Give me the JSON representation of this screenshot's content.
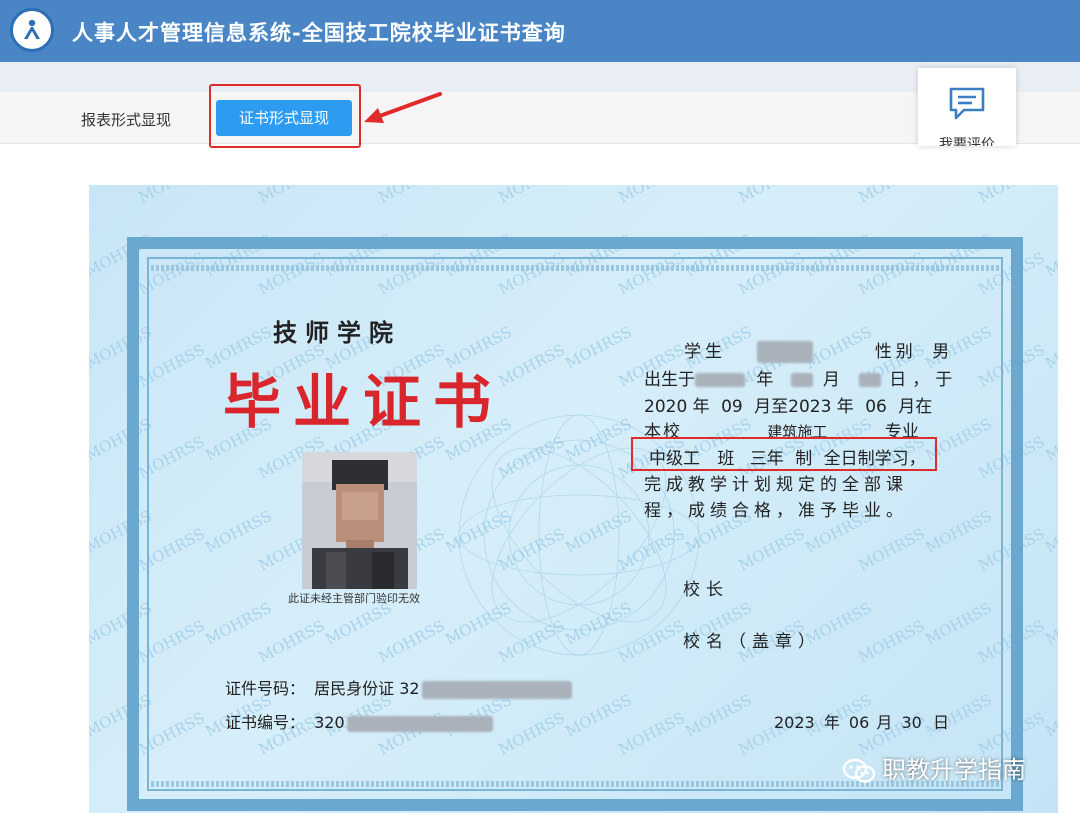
{
  "app": {
    "title": "人事人才管理信息系统-全国技工院校毕业证书查询"
  },
  "toolbar": {
    "report_view_label": "报表形式显现",
    "certificate_view_label": "证书形式显现",
    "feedback_label": "我要评价"
  },
  "certificate": {
    "school_name": "技师学院",
    "title": "毕业证书",
    "photo_note": "此证未经主管部门验印无效",
    "watermark_text": "MOHRSS",
    "student_label": "学生",
    "gender_label": "性别",
    "gender_value": "男",
    "birth_prefix": "出生于",
    "year_unit": "年",
    "month_unit": "月",
    "day_unit": "日，于",
    "start_year": "2020",
    "start_month": "09",
    "to_text": "至",
    "end_year": "2023",
    "end_month": "06",
    "month_at": "月在",
    "school_prefix": "本校",
    "major": "建筑施工",
    "major_suffix": "专业",
    "level": "中级工",
    "class_text": "班",
    "duration": "三年",
    "system_text": "制",
    "study_mode": "全日制学习，",
    "line_complete": "完成教学计划规定的全部课",
    "line_pass": "程，成绩合格，准予毕业。",
    "principal_label": "校长",
    "seal_label": "校名（盖章）",
    "id_label": "证件号码：",
    "id_type": "居民身份证 32",
    "cert_no_label": "证书编号：",
    "cert_no_prefix": "320",
    "issue_year": "2023",
    "issue_month": "06",
    "issue_day": "30",
    "issue_year_unit": "年",
    "issue_month_unit": "月",
    "issue_day_unit": "日"
  },
  "overlay": {
    "wechat_source": "职教升学指南"
  },
  "colors": {
    "header_bg": "#4a86c5",
    "active_tab_bg": "#2d9cf0",
    "annotation_red": "#e02b2b",
    "title_red": "#d8262c",
    "certificate_bg": "#d0ebf8"
  }
}
